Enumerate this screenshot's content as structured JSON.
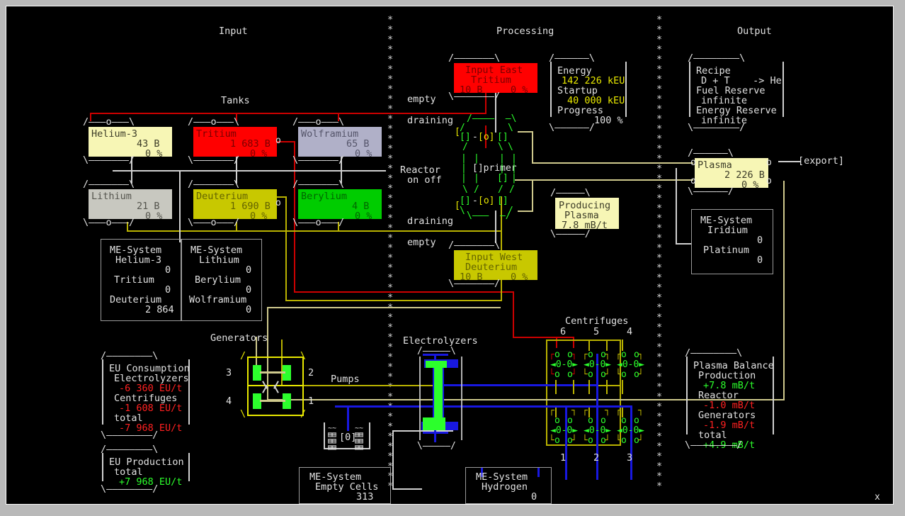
{
  "window": {
    "close_label": "x"
  },
  "columns": {
    "input": "Input",
    "processing": "Processing",
    "output": "Output"
  },
  "sections": {
    "tanks": "Tanks",
    "generators": "Generators",
    "electrolyzers": "Electrolyzers",
    "centrifuges": "Centrifuges",
    "pumps": "Pumps",
    "export": "[export]"
  },
  "tanks": [
    {
      "name": "Helium-3",
      "amount": "43 B",
      "percent": "0 %",
      "fill": "#f7f6b5",
      "text": "#3c3c28"
    },
    {
      "name": "Tritium",
      "amount": "1 683 B",
      "percent": "0 %",
      "fill": "#ff0000",
      "text": "#7a0000"
    },
    {
      "name": "Wolframium",
      "amount": "65 B",
      "percent": "0 %",
      "fill": "#b0b0c8",
      "text": "#55556a"
    },
    {
      "name": "Lithium",
      "amount": "21 B",
      "percent": "0 %",
      "fill": "#c8c8c0",
      "text": "#55554e"
    },
    {
      "name": "Deuterium",
      "amount": "1 690 B",
      "percent": "0 %",
      "fill": "#c8c800",
      "text": "#636300"
    },
    {
      "name": "Berylium",
      "amount": "4 B",
      "percent": "0 %",
      "fill": "#00cc00",
      "text": "#006600"
    }
  ],
  "inputs": {
    "east": {
      "title": "Input East",
      "material": "Tritium",
      "amount": "10 B",
      "percent": "0 %",
      "fill": "#ff0000",
      "text": "#7a0000"
    },
    "west": {
      "title": "Input West",
      "material": "Deuterium",
      "amount": "10 B",
      "percent": "0 %",
      "fill": "#c8c800",
      "text": "#636300"
    }
  },
  "reactor": {
    "label_reactor": "Reactor",
    "label_onoff": "on off",
    "primer": "[]primer",
    "status_top_empty": "empty",
    "status_top_draining": "draining",
    "status_bottom_draining": "draining",
    "status_bottom_empty": "empty"
  },
  "energy_panel": {
    "title": "Energy",
    "energy_value": "142 226 kEU",
    "startup_label": "Startup",
    "startup_value": "40 000 kEU",
    "progress_label": "Progress",
    "progress_value": "100 %"
  },
  "producing_panel": {
    "line1": "Producing",
    "line2": "Plasma",
    "line3": "7.8 mB/t"
  },
  "recipe_panel": {
    "title": "Recipe",
    "formula": "D + T    -> He",
    "fuel_reserve_label": "Fuel Reserve",
    "fuel_reserve_value": "infinite",
    "energy_reserve_label": "Energy Reserve",
    "energy_reserve_value": "infinite"
  },
  "plasma_tank": {
    "name": "Plasma",
    "amount": "2 226 B",
    "percent": "0 %",
    "fill": "#f7f6b5",
    "text": "#3c3c28"
  },
  "me_systems": [
    {
      "id": "me-helium3",
      "title": "ME-System",
      "rows": [
        {
          "label": "Helium-3",
          "value": "0"
        },
        {
          "label": "Tritium",
          "value": "0"
        },
        {
          "label": "Deuterium",
          "value": "2 864"
        }
      ]
    },
    {
      "id": "me-lithium",
      "title": "ME-System",
      "rows": [
        {
          "label": "Lithium",
          "value": "0"
        },
        {
          "label": "Berylium",
          "value": "0"
        },
        {
          "label": "Wolframium",
          "value": "0"
        }
      ]
    },
    {
      "id": "me-iridium",
      "title": "ME-System",
      "rows": [
        {
          "label": "Iridium",
          "value": "0"
        },
        {
          "label": "Platinum",
          "value": "0"
        }
      ]
    },
    {
      "id": "me-empty-cells",
      "title": "ME-System",
      "rows": [
        {
          "label": "Empty Cells",
          "value": "313"
        }
      ]
    },
    {
      "id": "me-hydrogen",
      "title": "ME-System",
      "rows": [
        {
          "label": "Hydrogen",
          "value": "0"
        }
      ]
    }
  ],
  "eu_consumption": {
    "title": "EU Consumption",
    "rows": [
      {
        "label": "Electrolyzers",
        "value": "-6 360 EU/t",
        "color": "#ff2020"
      },
      {
        "label": "Centrifuges",
        "value": "-1 608 EU/t",
        "color": "#ff2020"
      },
      {
        "label": "total",
        "value": "-7 968 EU/t",
        "color": "#ff2020"
      }
    ]
  },
  "eu_production": {
    "title": "EU Production",
    "rows": [
      {
        "label": "total",
        "value": "+7 968 EU/t",
        "color": "#2cff2c"
      }
    ]
  },
  "plasma_balance": {
    "title": "Plasma Balance",
    "rows": [
      {
        "label": "Production",
        "value": "+7.8 mB/t",
        "color": "#2cff2c"
      },
      {
        "label": "Reactor",
        "value": "-1.0 mB/t",
        "color": "#ff2020"
      },
      {
        "label": "Generators",
        "value": "-1.9 mB/t",
        "color": "#ff2020"
      },
      {
        "label": "total",
        "value": "+4.9 mB/t",
        "color": "#2cff2c"
      }
    ]
  },
  "generators": {
    "numbers": [
      "3",
      "2",
      "4",
      "1"
    ]
  },
  "centrifuges": {
    "top_numbers": [
      "6",
      "5",
      "4"
    ],
    "bottom_numbers": [
      "1",
      "2",
      "3"
    ]
  },
  "tank_gauge": {
    "value": "[0]"
  },
  "colors": {
    "background": "#000000",
    "foreground": "#e2e2e2",
    "wire_red": "#cc0000",
    "wire_yellow": "#b9b200",
    "wire_khaki": "#cfc98d",
    "wire_blue": "#1818e0",
    "accent_green": "#2cff2c",
    "accent_yellow": "#e8e800"
  }
}
